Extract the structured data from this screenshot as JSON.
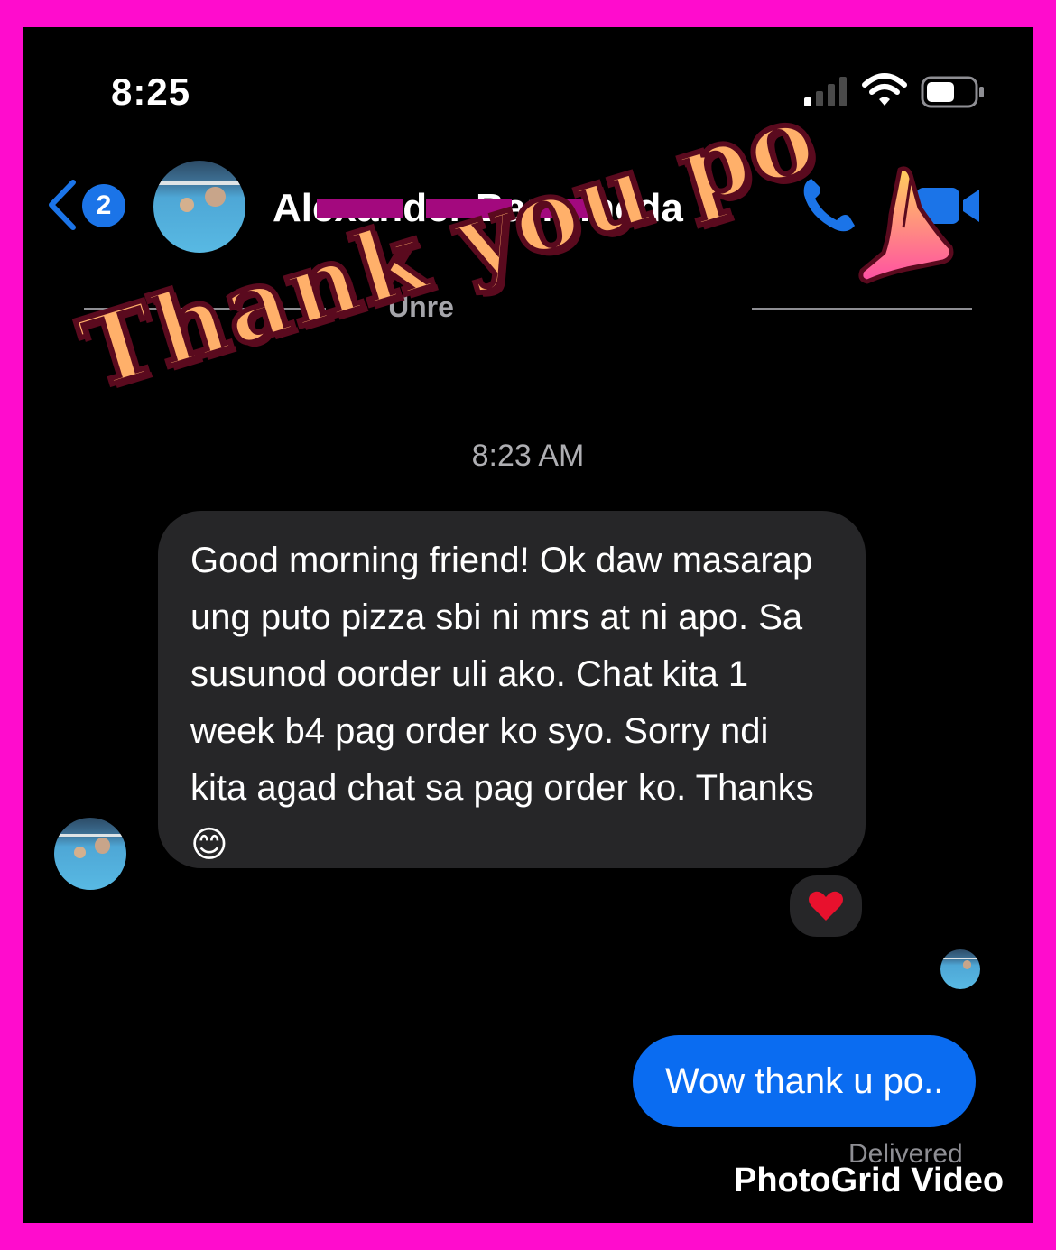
{
  "status_bar": {
    "time": "8:25"
  },
  "header": {
    "unread_badge": "2",
    "contact_name": "Alexander Barrameda",
    "icons": [
      "back-chevron-icon",
      "phone-icon",
      "video-camera-icon"
    ]
  },
  "unread_divider": {
    "label": "Unre"
  },
  "sticker": {
    "text": "Thank you po",
    "emoji": "folded-hands-icon"
  },
  "conversation": {
    "timestamp": "8:23 AM",
    "incoming": {
      "text": "Good morning friend! Ok daw masarap ung puto pizza sbi ni mrs at ni apo. Sa susunod oorder uli ako. Chat kita 1 week b4 pag order ko syo. Sorry ndi kita agad chat sa pag order ko. Thanks",
      "emoji": "😊",
      "reaction": "❤️"
    },
    "outgoing": {
      "text": "Wow thank u po..",
      "status": "Delivered"
    }
  },
  "watermark": {
    "text": "PhotoGrid Video"
  },
  "colors": {
    "frame": "#ff0ccd",
    "accent_blue": "#0a6cf1",
    "incoming_bubble": "#262628",
    "redaction": "#a3097e"
  }
}
